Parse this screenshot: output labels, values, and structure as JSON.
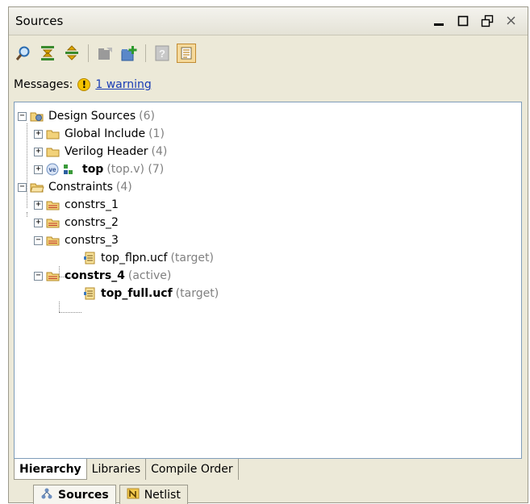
{
  "window": {
    "title": "Sources",
    "controls": [
      "minimize-icon",
      "maximize-icon",
      "restore-icon",
      "close-icon"
    ]
  },
  "toolbar": {
    "buttons": [
      "search-icon",
      "collapse-all-icon",
      "expand-all-icon",
      "edit-sources-icon",
      "add-sources-icon",
      "help-icon",
      "show-hierarchy-icon"
    ]
  },
  "messages": {
    "label": "Messages:",
    "warning_icon": "!",
    "warning_link": "1 warning"
  },
  "tree": {
    "design_sources": {
      "label": "Design Sources",
      "count": "(6)"
    },
    "global_include": {
      "label": "Global Include",
      "count": "(1)"
    },
    "verilog_header": {
      "label": "Verilog Header",
      "count": "(4)"
    },
    "top": {
      "label": "top",
      "detail": "(top.v) (7)"
    },
    "constraints": {
      "label": "Constraints",
      "count": "(4)"
    },
    "constrs_1": {
      "label": "constrs_1"
    },
    "constrs_2": {
      "label": "constrs_2"
    },
    "constrs_3": {
      "label": "constrs_3"
    },
    "top_flpn": {
      "label": "top_flpn.ucf",
      "detail": "(target)"
    },
    "constrs_4": {
      "label": "constrs_4",
      "detail": "(active)"
    },
    "top_full": {
      "label": "top_full.ucf",
      "detail": "(target)"
    }
  },
  "view_tabs": {
    "hierarchy": "Hierarchy",
    "libraries": "Libraries",
    "compile_order": "Compile Order"
  },
  "panel_tabs": {
    "sources": "Sources",
    "netlist": "Netlist"
  },
  "colors": {
    "folder": "#f2d27a",
    "warning": "#f3c300",
    "link": "#1a3db5"
  }
}
